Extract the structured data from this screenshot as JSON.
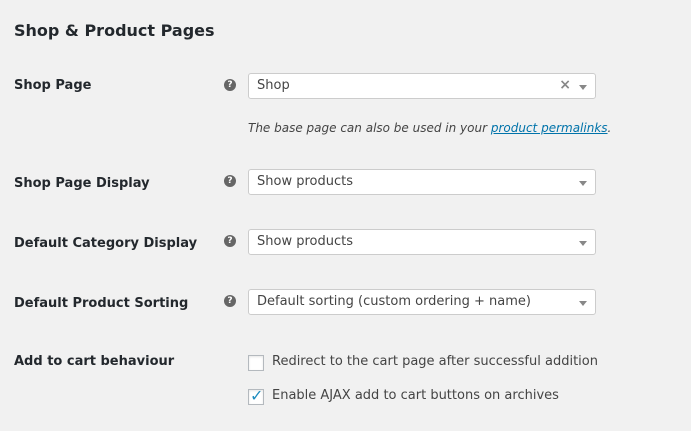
{
  "section": {
    "title": "Shop & Product Pages"
  },
  "rows": {
    "shop_page": {
      "label": "Shop Page",
      "value": "Shop",
      "clear_glyph": "×",
      "description_prefix": "The base page can also be used in your ",
      "description_link": "product permalinks",
      "description_suffix": "."
    },
    "shop_page_display": {
      "label": "Shop Page Display",
      "value": "Show products"
    },
    "default_category_display": {
      "label": "Default Category Display",
      "value": "Show products"
    },
    "default_product_sorting": {
      "label": "Default Product Sorting",
      "value": "Default sorting (custom ordering + name)"
    },
    "add_to_cart": {
      "label": "Add to cart behaviour",
      "options": [
        {
          "label": "Redirect to the cart page after successful addition",
          "checked": false
        },
        {
          "label": "Enable AJAX add to cart buttons on archives",
          "checked": true
        }
      ]
    }
  },
  "icons": {
    "help": "?",
    "check": "✓"
  },
  "colors": {
    "link": "#0073aa",
    "check": "#1e8cbe",
    "background": "#f1f1f1"
  }
}
